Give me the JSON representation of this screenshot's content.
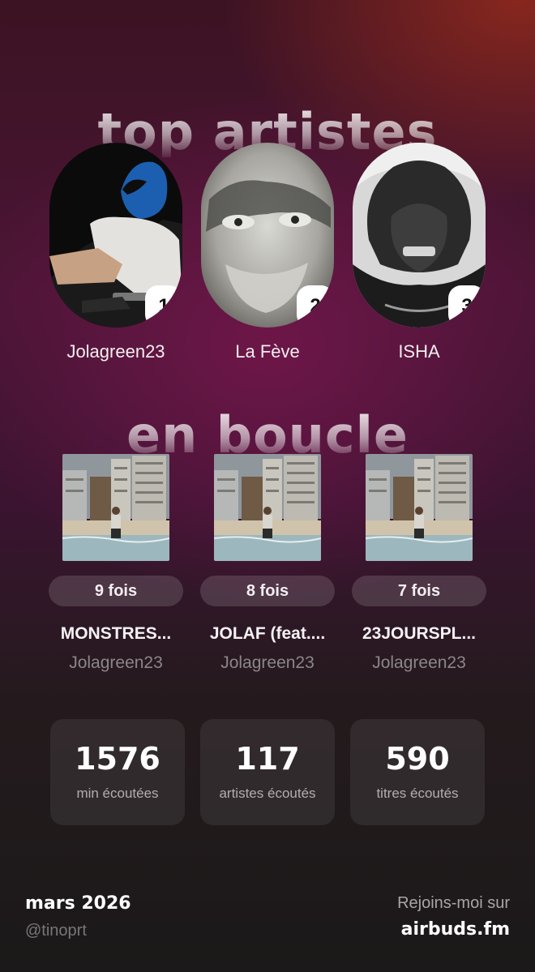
{
  "sections": {
    "top_artists_title": "top artistes",
    "loop_title": "en boucle"
  },
  "artists": [
    {
      "rank": "1",
      "name": "Jolagreen23",
      "photo_icon": "artist-photo-masked-rider"
    },
    {
      "rank": "2",
      "name": "La Fève",
      "photo_icon": "artist-photo-blurred-face"
    },
    {
      "rank": "3",
      "name": "ISHA",
      "photo_icon": "artist-photo-hands-on-head"
    }
  ],
  "tracks": [
    {
      "plays": "9 fois",
      "title": "MONSTRES...",
      "artist": "Jolagreen23",
      "cover_icon": "album-cover-beach-buildings"
    },
    {
      "plays": "8 fois",
      "title": "JOLAF (feat....",
      "artist": "Jolagreen23",
      "cover_icon": "album-cover-beach-buildings"
    },
    {
      "plays": "7 fois",
      "title": "23JOURSPL...",
      "artist": "Jolagreen23",
      "cover_icon": "album-cover-beach-buildings"
    }
  ],
  "stats": [
    {
      "value": "1576",
      "label": "min écoutées"
    },
    {
      "value": "117",
      "label": "artistes écoutés"
    },
    {
      "value": "590",
      "label": "titres écoutés"
    }
  ],
  "footer": {
    "date": "mars 2026",
    "username": "@tinoprt",
    "cta": "Rejoins-moi sur",
    "site": "airbuds.fm"
  },
  "colors": {
    "accent_top": "#8c281e",
    "accent_mid": "#70164a",
    "background_bottom": "#1b1919",
    "rank_badge": "#ffffff"
  }
}
